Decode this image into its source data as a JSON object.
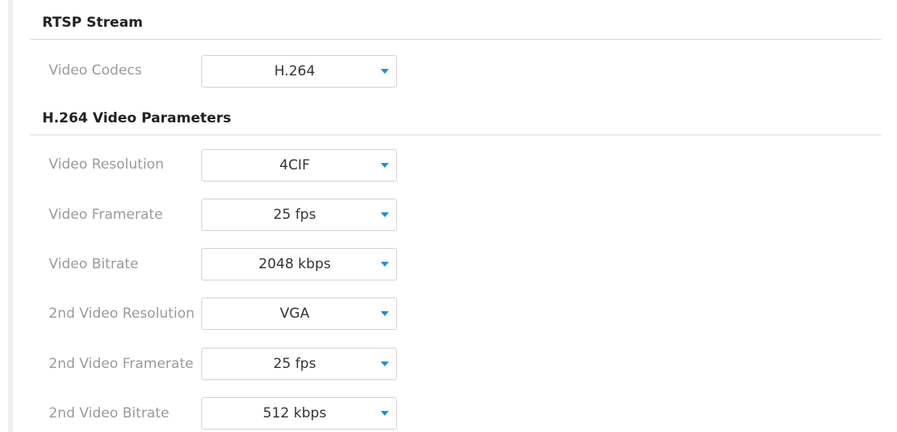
{
  "sections": {
    "rtsp": {
      "title": "RTSP Stream"
    },
    "h264": {
      "title": "H.264 Video Parameters"
    }
  },
  "fields": {
    "video_codecs": {
      "label": "Video Codecs",
      "value": "H.264"
    },
    "video_resolution": {
      "label": "Video Resolution",
      "value": "4CIF"
    },
    "video_framerate": {
      "label": "Video Framerate",
      "value": "25 fps"
    },
    "video_bitrate": {
      "label": "Video Bitrate",
      "value": "2048 kbps"
    },
    "second_video_resolution": {
      "label": "2nd Video Resolution",
      "value": "VGA"
    },
    "second_video_framerate": {
      "label": "2nd Video Framerate",
      "value": "25 fps"
    },
    "second_video_bitrate": {
      "label": "2nd Video Bitrate",
      "value": "512 kbps"
    }
  },
  "icons": {
    "dropdown": "chevron-down-icon"
  },
  "colors": {
    "accent": "#1a8fe0",
    "label_text": "#9a9a9a",
    "heading_text": "#222222",
    "value_text": "#333333",
    "border": "#d2d2d2",
    "divider": "#dcdcdc"
  }
}
